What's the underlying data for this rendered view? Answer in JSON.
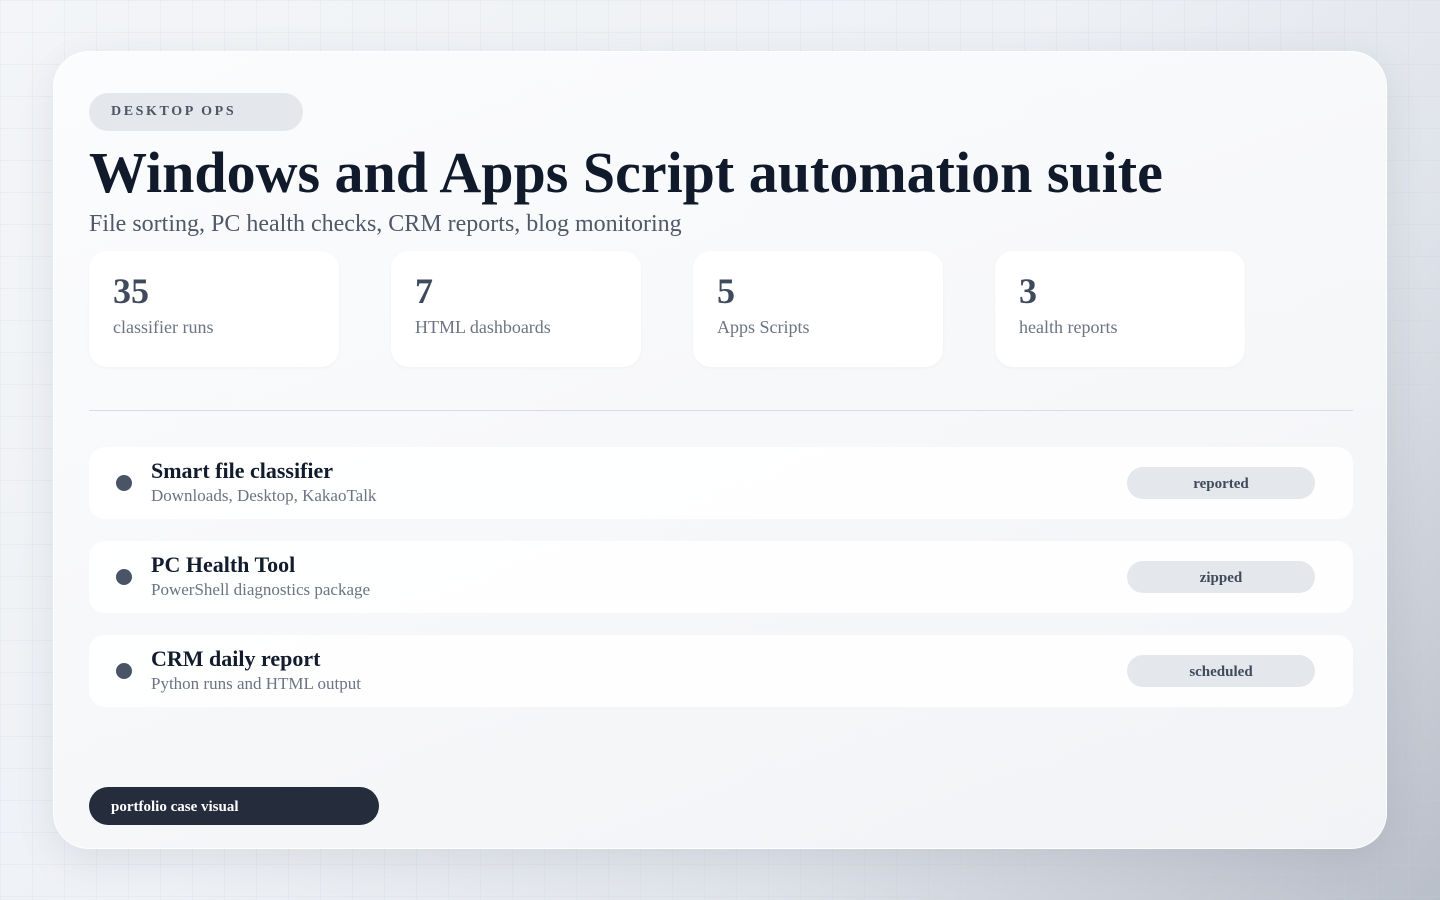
{
  "header": {
    "eyebrow": "DESKTOP OPS",
    "title": "Windows and Apps Script automation suite",
    "subtitle": "File sorting, PC health checks, CRM reports, blog monitoring"
  },
  "stats": [
    {
      "value": "35",
      "label": "classifier runs"
    },
    {
      "value": "7",
      "label": "HTML dashboards"
    },
    {
      "value": "5",
      "label": "Apps Scripts"
    },
    {
      "value": "3",
      "label": "health reports"
    }
  ],
  "rows": [
    {
      "title": "Smart file classifier",
      "subtitle": "Downloads, Desktop, KakaoTalk",
      "status": "reported"
    },
    {
      "title": "PC Health Tool",
      "subtitle": "PowerShell diagnostics package",
      "status": "zipped"
    },
    {
      "title": "CRM daily report",
      "subtitle": "Python runs and HTML output",
      "status": "scheduled"
    }
  ],
  "footer": {
    "tag": "portfolio case visual"
  },
  "colors": {
    "ink": "#101a2b",
    "muted": "#6b7483",
    "dot": "#4a5467",
    "badge_bg": "#e4e7eb",
    "footer_bg": "#252c3c"
  }
}
